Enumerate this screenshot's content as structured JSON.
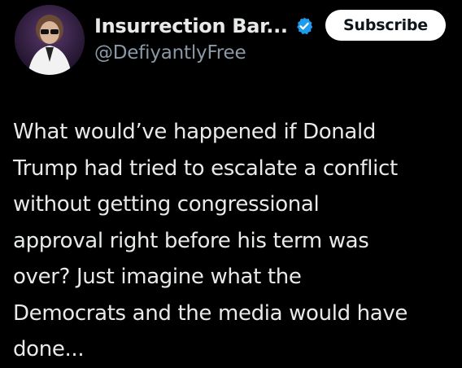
{
  "author": {
    "display_name": "Insurrection Bar...",
    "handle": "@DefiyantlyFree",
    "verified": true,
    "avatar_icon": "profile-photo"
  },
  "actions": {
    "subscribe_label": "Subscribe"
  },
  "tweet": {
    "lines": [
      "What would’ve happened if Donald",
      "Trump had tried to escalate a conflict",
      "without getting congressional",
      "approval right before his term was",
      "over? Just imagine what the",
      "Democrats and the media would have",
      "done..."
    ]
  },
  "colors": {
    "background": "#000000",
    "text_primary": "#e7e9ea",
    "text_secondary": "#8b98a5",
    "verified_badge": "#1d9bf0",
    "subscribe_bg": "#ffffff",
    "subscribe_text": "#0f1419"
  }
}
